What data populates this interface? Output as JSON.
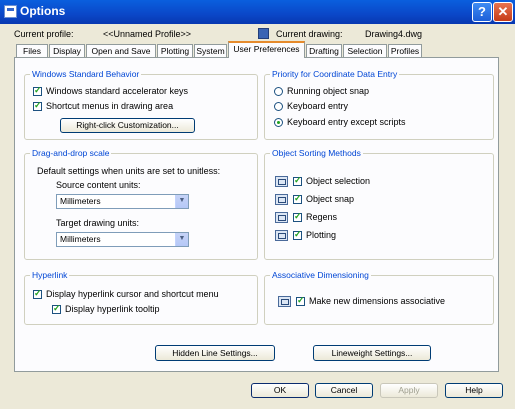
{
  "window": {
    "title": "Options",
    "help_glyph": "?",
    "close_glyph": "✕"
  },
  "header": {
    "current_profile_label": "Current profile:",
    "current_profile_value": "<<Unnamed Profile>>",
    "current_drawing_label": "Current drawing:",
    "current_drawing_value": "Drawing4.dwg"
  },
  "tabs": [
    {
      "label": "Files"
    },
    {
      "label": "Display"
    },
    {
      "label": "Open and Save"
    },
    {
      "label": "Plotting"
    },
    {
      "label": "System"
    },
    {
      "label": "User Preferences"
    },
    {
      "label": "Drafting"
    },
    {
      "label": "Selection"
    },
    {
      "label": "Profiles"
    }
  ],
  "active_tab": "User Preferences",
  "windows_standard": {
    "title": "Windows Standard Behavior",
    "accelerator_keys": {
      "label": "Windows standard accelerator keys",
      "checked": true
    },
    "shortcut_menus": {
      "label": "Shortcut menus in drawing area",
      "checked": true
    },
    "customization_button": "Right-click Customization..."
  },
  "drag_drop": {
    "title": "Drag-and-drop scale",
    "description": "Default settings when units are set to unitless:",
    "source_label": "Source content units:",
    "source_value": "Millimeters",
    "target_label": "Target drawing units:",
    "target_value": "Millimeters"
  },
  "hyperlink": {
    "title": "Hyperlink",
    "cursor_menu": {
      "label": "Display hyperlink cursor and shortcut menu",
      "checked": true
    },
    "tooltip": {
      "label": "Display hyperlink tooltip",
      "checked": true
    }
  },
  "priority": {
    "title": "Priority for Coordinate Data Entry",
    "options": [
      {
        "label": "Running object snap",
        "selected": false
      },
      {
        "label": "Keyboard entry",
        "selected": false
      },
      {
        "label": "Keyboard entry except scripts",
        "selected": true
      }
    ]
  },
  "object_sorting": {
    "title": "Object Sorting Methods",
    "items": [
      {
        "label": "Object selection",
        "checked": true
      },
      {
        "label": "Object snap",
        "checked": true
      },
      {
        "label": "Regens",
        "checked": true
      },
      {
        "label": "Plotting",
        "checked": true
      }
    ]
  },
  "associative": {
    "title": "Associative Dimensioning",
    "make_associative": {
      "label": "Make new dimensions associative",
      "checked": true
    }
  },
  "buttons": {
    "hidden_line": "Hidden Line Settings...",
    "lineweight": "Lineweight Settings...",
    "ok": "OK",
    "cancel": "Cancel",
    "apply": "Apply",
    "help": "Help"
  }
}
